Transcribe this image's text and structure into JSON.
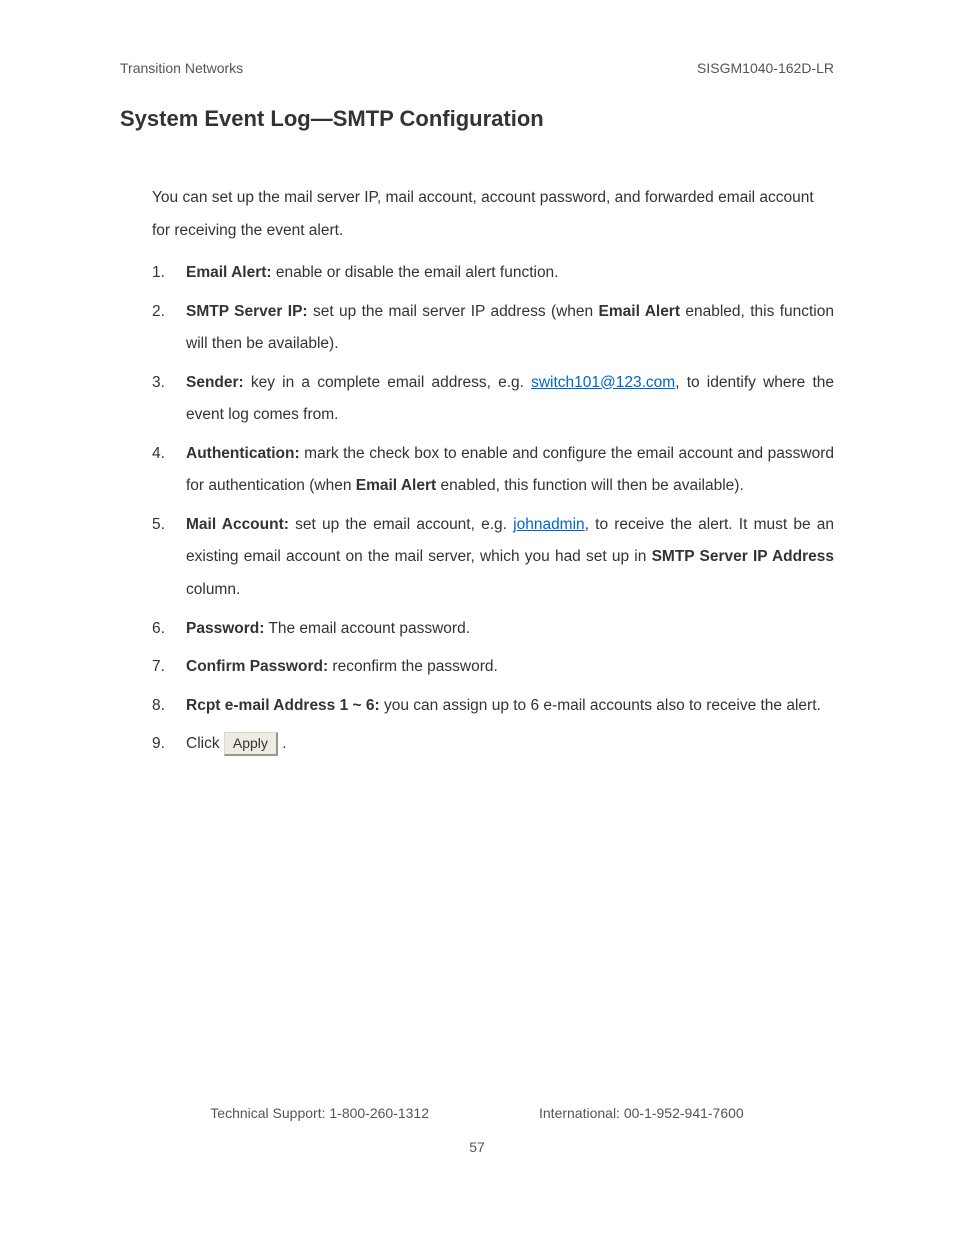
{
  "header": {
    "left": "Transition Networks",
    "right": "SISGM1040-162D-LR"
  },
  "title": "System Event Log—SMTP Configuration",
  "intro": "You can set up the mail server IP, mail account, account password, and forwarded email account for receiving the event alert.",
  "items": [
    {
      "num": "1.",
      "label": "Email Alert:",
      "text": " enable or disable the email alert function."
    },
    {
      "num": "2.",
      "label": "SMTP Server IP:",
      "text_a": " set up the mail server IP address (when ",
      "bold_a": "Email Alert",
      "text_b": " enabled, this function will then be available)."
    },
    {
      "num": "3.",
      "label": "Sender:",
      "text_a": " key in a complete email address, e.g. ",
      "link": "switch101@123.com",
      "text_b": ", to identify where the event log comes from."
    },
    {
      "num": "4.",
      "label": "Authentication:",
      "text_a": " mark the check box to enable and configure the email account and password for authentication (when ",
      "bold_a": "Email Alert",
      "text_b": " enabled, this function will then be available)."
    },
    {
      "num": "5.",
      "label": "Mail Account:",
      "text_a": " set up the email account, e.g. ",
      "link": "johnadmin",
      "text_b": ", to receive the alert. It must be an existing email account on the mail server, which you had set up in ",
      "bold_a": "SMTP Server IP Address",
      "text_c": " column."
    },
    {
      "num": "6.",
      "label": "Password:",
      "text": " The email account password."
    },
    {
      "num": "7.",
      "label": "Confirm Password:",
      "text": " reconfirm the password."
    },
    {
      "num": "8.",
      "label": "Rcpt e-mail Address 1 ~ 6:",
      "text": " you can assign up to 6 e-mail accounts also to receive the alert."
    },
    {
      "num": "9.",
      "text_a": "Click ",
      "button": "Apply",
      "text_b": " ."
    }
  ],
  "footer": {
    "support": "Technical Support: 1-800-260-1312",
    "intl": "International: 00-1-952-941-7600",
    "page": "57"
  }
}
